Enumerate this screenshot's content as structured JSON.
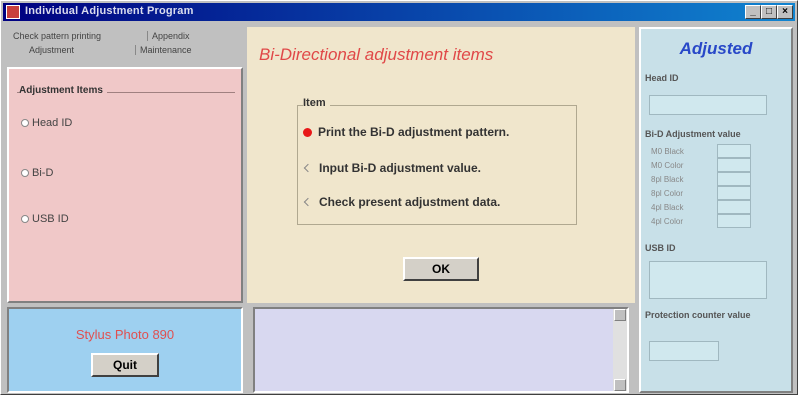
{
  "window": {
    "title": "Individual Adjustment Program",
    "controls": [
      "_",
      "□",
      "×"
    ]
  },
  "tabs": {
    "row1": [
      "Check pattern printing",
      "Appendix"
    ],
    "row2": [
      "Adjustment",
      "Maintenance"
    ]
  },
  "left": {
    "group_label": "Adjustment Items",
    "items": [
      "Head ID",
      "Bi-D",
      "USB ID"
    ],
    "model": "Stylus Photo 890",
    "quit_label": "Quit"
  },
  "center": {
    "heading": "Bi-Directional adjustment items",
    "group_label": "Item",
    "options": [
      "Print the Bi-D adjustment pattern.",
      "Input Bi-D adjustment value.",
      "Check present adjustment data."
    ],
    "ok_label": "OK"
  },
  "right": {
    "title": "Adjusted",
    "head_id_label": "Head ID",
    "bid_label": "Bi-D Adjustment value",
    "bid_rows": [
      "M0 Black",
      "M0 Color",
      "8pl Black",
      "8pl Color",
      "4pl Black",
      "4pl Color"
    ],
    "usb_label": "USB ID",
    "counter_label": "Protection counter value"
  },
  "colors": {
    "accent_red": "#e04848",
    "accent_blue": "#2848c8",
    "selected_radio": "#e81818"
  }
}
